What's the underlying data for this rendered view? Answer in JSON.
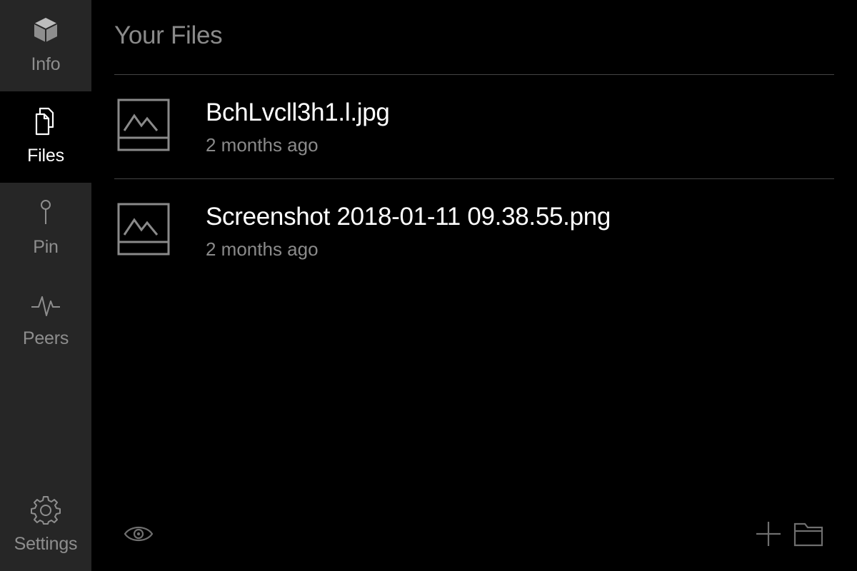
{
  "sidebar": {
    "items": [
      {
        "label": "Info",
        "icon": "cube-icon"
      },
      {
        "label": "Files",
        "icon": "files-icon",
        "active": true
      },
      {
        "label": "Pin",
        "icon": "pin-icon"
      },
      {
        "label": "Peers",
        "icon": "pulse-icon"
      }
    ],
    "settings": {
      "label": "Settings",
      "icon": "gear-icon"
    }
  },
  "main": {
    "title": "Your Files",
    "files": [
      {
        "name": "BchLvcll3h1.l.jpg",
        "time": "2 months ago",
        "icon": "image-icon"
      },
      {
        "name": "Screenshot 2018-01-11 09.38.55.png",
        "time": "2 months ago",
        "icon": "image-icon"
      }
    ],
    "footer": {
      "left": [
        "eye-icon"
      ],
      "right": [
        "plus-icon",
        "folder-icon"
      ]
    }
  },
  "colors": {
    "sidebar_bg": "#262626",
    "main_bg": "#000000",
    "active_text": "#ffffff",
    "muted_text": "#8a8a8a",
    "divider": "#444444"
  }
}
